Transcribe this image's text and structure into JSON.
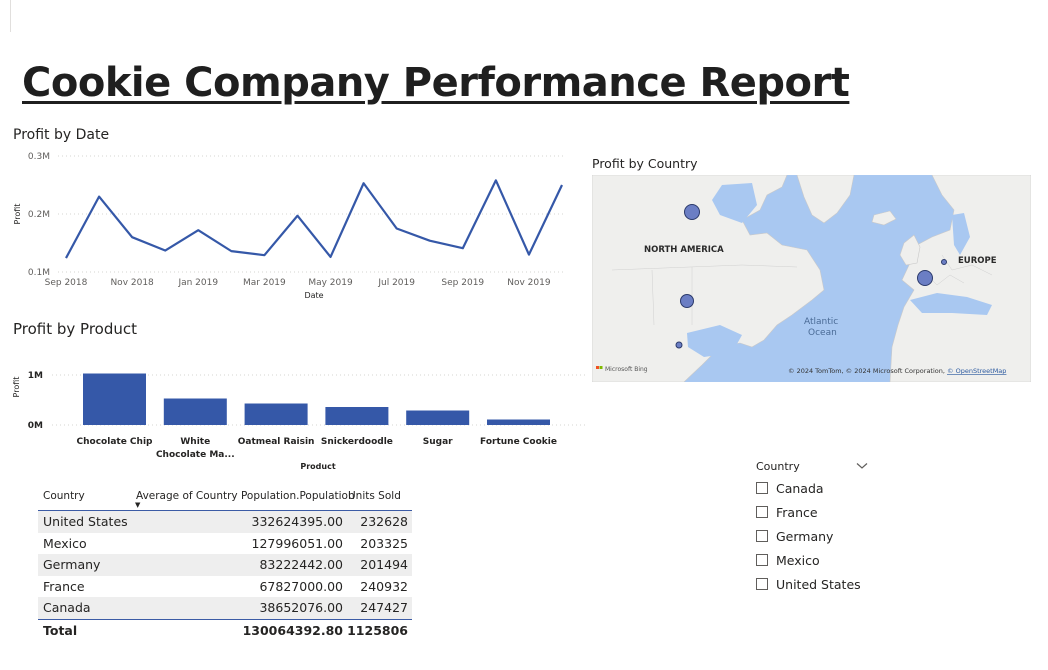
{
  "report": {
    "title": "Cookie Company Performance Report"
  },
  "profit_by_date": {
    "title": "Profit by Date",
    "ylabel": "Profit",
    "xlabel": "Date",
    "y_ticks": [
      "0.1M",
      "0.2M",
      "0.3M"
    ],
    "x_ticks": [
      "Sep 2018",
      "Nov 2018",
      "Jan 2019",
      "Mar 2019",
      "May 2019",
      "Jul 2019",
      "Sep 2019",
      "Nov 2019"
    ]
  },
  "profit_by_product": {
    "title": "Profit by Product",
    "ylabel": "Profit",
    "xlabel": "Product",
    "y_ticks": [
      "0M",
      "1M"
    ],
    "categories": [
      "Chocolate Chip",
      "White Chocolate Ma...",
      "Oatmeal Raisin",
      "Snickerdoodle",
      "Sugar",
      "Fortune Cookie"
    ]
  },
  "map": {
    "title": "Profit by Country",
    "labels": {
      "north_america": "NORTH AMERICA",
      "europe": "EUROPE",
      "atlantic": "Atlantic",
      "ocean": "Ocean"
    },
    "attribution": "© 2024 TomTom, © 2024 Microsoft Corporation, ",
    "attribution_link": "© OpenStreetMap",
    "bing_logo": "Microsoft Bing",
    "bubbles": [
      {
        "country": "Canada",
        "relative_size": 1.0
      },
      {
        "country": "United States",
        "relative_size": 0.9
      },
      {
        "country": "Mexico",
        "relative_size": 0.4
      },
      {
        "country": "France",
        "relative_size": 1.0
      },
      {
        "country": "Germany",
        "relative_size": 0.35
      }
    ],
    "colors": {
      "water": "#a7c7f0",
      "land": "#eeeeec",
      "bubble": "#6b7ec4",
      "bubble_stroke": "#2b3a6b"
    }
  },
  "table": {
    "headers": {
      "country": "Country",
      "population": "Average of Country Population.Population",
      "units": "Units Sold"
    },
    "rows": [
      {
        "country": "United States",
        "population": "332624395.00",
        "units": "232628"
      },
      {
        "country": "Mexico",
        "population": "127996051.00",
        "units": "203325"
      },
      {
        "country": "Germany",
        "population": "83222442.00",
        "units": "201494"
      },
      {
        "country": "France",
        "population": "67827000.00",
        "units": "240932"
      },
      {
        "country": "Canada",
        "population": "38652076.00",
        "units": "247427"
      }
    ],
    "total": {
      "label": "Total",
      "population": "130064392.80",
      "units": "1125806"
    }
  },
  "slicer": {
    "title": "Country",
    "items": [
      "Canada",
      "France",
      "Germany",
      "Mexico",
      "United States"
    ]
  },
  "colors": {
    "accent": "#3558a8",
    "gridline": "#c8c6c4",
    "text": "#252423"
  },
  "chart_data": [
    {
      "type": "line",
      "title": "Profit by Date",
      "xlabel": "Date",
      "ylabel": "Profit",
      "x": [
        "Sep 2018",
        "Oct 2018",
        "Nov 2018",
        "Dec 2018",
        "Jan 2019",
        "Feb 2019",
        "Mar 2019",
        "Apr 2019",
        "May 2019",
        "Jun 2019",
        "Jul 2019",
        "Aug 2019",
        "Sep 2019",
        "Oct 2019",
        "Nov 2019",
        "Dec 2019"
      ],
      "series": [
        {
          "values": [
            0.124,
            0.23,
            0.16,
            0.137,
            0.172,
            0.136,
            0.129,
            0.197,
            0.126,
            0.253,
            0.175,
            0.154,
            0.141,
            0.258,
            0.13,
            0.25
          ]
        }
      ],
      "ylim": [
        0.1,
        0.3
      ],
      "y_unit": "M",
      "grid": true
    },
    {
      "type": "bar",
      "title": "Profit by Product",
      "xlabel": "Product",
      "ylabel": "Profit",
      "categories": [
        "Chocolate Chip",
        "White Chocolate Ma...",
        "Oatmeal Raisin",
        "Snickerdoodle",
        "Sugar",
        "Fortune Cookie"
      ],
      "values": [
        1.03,
        0.53,
        0.43,
        0.36,
        0.29,
        0.11
      ],
      "ylim": [
        0,
        1.0
      ],
      "y_unit": "M",
      "grid": true
    }
  ]
}
